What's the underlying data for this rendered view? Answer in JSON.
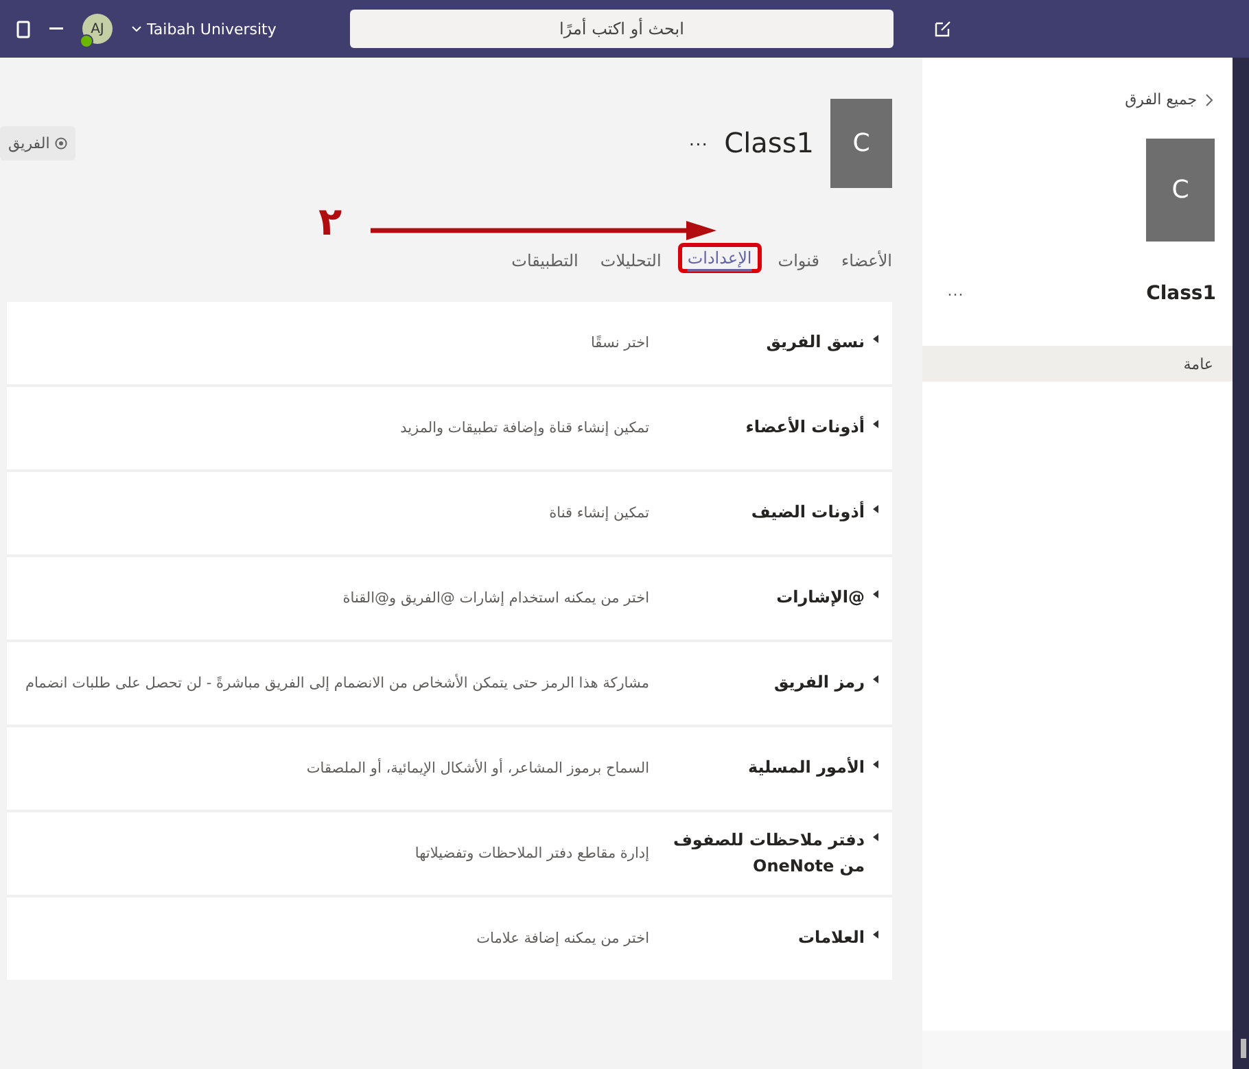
{
  "top_bar": {
    "organization": "Taibah University",
    "avatar_initials": "AJ",
    "search": {
      "placeholder": "ابحث أو اكتب أمرًا"
    }
  },
  "team_header": {
    "tile_letter": "C",
    "name": "Class1",
    "more": "···",
    "team_button": "الفريق"
  },
  "tabs": [
    {
      "label": "الأعضاء",
      "selected": false
    },
    {
      "label": "قنوات",
      "selected": false
    },
    {
      "label": "الإعدادات",
      "selected": true
    },
    {
      "label": "التحليلات",
      "selected": false
    },
    {
      "label": "التطبيقات",
      "selected": false
    }
  ],
  "annotation": {
    "step": "٢"
  },
  "settings": [
    {
      "title": "نسق الفريق",
      "description": "اختر نسقًا"
    },
    {
      "title": "أذونات الأعضاء",
      "description": "تمكين إنشاء قناة وإضافة تطبيقات والمزيد"
    },
    {
      "title": "أذونات الضيف",
      "description": "تمكين إنشاء قناة"
    },
    {
      "title": "@الإشارات",
      "description": "اختر من يمكنه استخدام إشارات @الفريق و@القناة"
    },
    {
      "title": "رمز الفريق",
      "description": "مشاركة هذا الرمز حتى يتمكن الأشخاص من الانضمام إلى الفريق مباشرةً - لن تحصل على طلبات انضمام"
    },
    {
      "title": "الأمور المسلية",
      "description": "السماح برموز المشاعر، أو الأشكال الإيمائية، أو الملصقات"
    },
    {
      "title": "دفتر ملاحظات للصفوف من OneNote",
      "description": "إدارة مقاطع دفتر الملاحظات وتفضيلاتها"
    },
    {
      "title": "العلامات",
      "description": "اختر من يمكنه إضافة علامات"
    }
  ],
  "sidebar": {
    "back": "جميع الفرق",
    "tile_letter": "C",
    "team_name": "Class1",
    "more": "···",
    "channels": [
      {
        "label": "عامة",
        "selected": true
      }
    ]
  }
}
